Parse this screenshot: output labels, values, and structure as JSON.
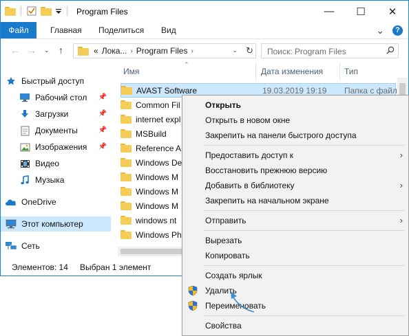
{
  "window": {
    "title": "Program Files",
    "minimize": "—",
    "maximize": "☐",
    "close": "✕"
  },
  "ribbon": {
    "tabs": [
      "Файл",
      "Главная",
      "Поделиться",
      "Вид"
    ],
    "collapse": "⌄",
    "help": "?"
  },
  "address": {
    "prefix": "«",
    "crumbs": [
      "Лока...",
      "Program Files"
    ],
    "search_placeholder": "Поиск: Program Files"
  },
  "nav": {
    "quick_access": "Быстрый доступ",
    "items": [
      {
        "label": "Рабочий стол",
        "icon": "desktop-icon",
        "pinned": true
      },
      {
        "label": "Загрузки",
        "icon": "download-icon",
        "pinned": true
      },
      {
        "label": "Документы",
        "icon": "documents-icon",
        "pinned": true
      },
      {
        "label": "Изображения",
        "icon": "pictures-icon",
        "pinned": true
      },
      {
        "label": "Видео",
        "icon": "video-icon",
        "pinned": false
      },
      {
        "label": "Музыка",
        "icon": "music-icon",
        "pinned": false
      }
    ],
    "onedrive": "OneDrive",
    "this_pc": "Этот компьютер",
    "network": "Сеть"
  },
  "columns": {
    "name": "Имя",
    "date": "Дата изменения",
    "type": "Тип"
  },
  "files": [
    {
      "name": "AVAST Software",
      "date": "19.03.2019 19:19",
      "type": "Папка с файл",
      "selected": true
    },
    {
      "name": "Common Fil",
      "date": "",
      "type": "",
      "selected": false
    },
    {
      "name": "internet expl",
      "date": "",
      "type": "",
      "selected": false
    },
    {
      "name": "MSBuild",
      "date": "",
      "type": "",
      "selected": false
    },
    {
      "name": "Reference A",
      "date": "",
      "type": "",
      "selected": false
    },
    {
      "name": "Windows De",
      "date": "",
      "type": "",
      "selected": false
    },
    {
      "name": "Windows M",
      "date": "",
      "type": "",
      "selected": false
    },
    {
      "name": "Windows M",
      "date": "",
      "type": "",
      "selected": false
    },
    {
      "name": "Windows M",
      "date": "",
      "type": "",
      "selected": false
    },
    {
      "name": "windows nt",
      "date": "",
      "type": "",
      "selected": false
    },
    {
      "name": "Windows Ph",
      "date": "",
      "type": "",
      "selected": false
    }
  ],
  "status": {
    "count": "Элементов: 14",
    "selected": "Выбран 1 элемент"
  },
  "context_menu": {
    "open": "Открыть",
    "open_new_window": "Открыть в новом окне",
    "pin_quick_access": "Закрепить на панели быстрого доступа",
    "give_access": "Предоставить доступ к",
    "restore_previous": "Восстановить прежнюю версию",
    "add_to_library": "Добавить в библиотеку",
    "pin_start": "Закрепить на начальном экране",
    "send_to": "Отправить",
    "cut": "Вырезать",
    "copy": "Копировать",
    "create_shortcut": "Создать ярлык",
    "delete": "Удалить",
    "rename": "Переименовать",
    "properties": "Свойства",
    "submenu_arrow": "›"
  },
  "colors": {
    "accent": "#1979ca",
    "selection": "#cce8ff",
    "folder": "#f5cd56",
    "menu_bg": "#f2f2f2",
    "pointer_arrow": "#3a8fd6"
  }
}
